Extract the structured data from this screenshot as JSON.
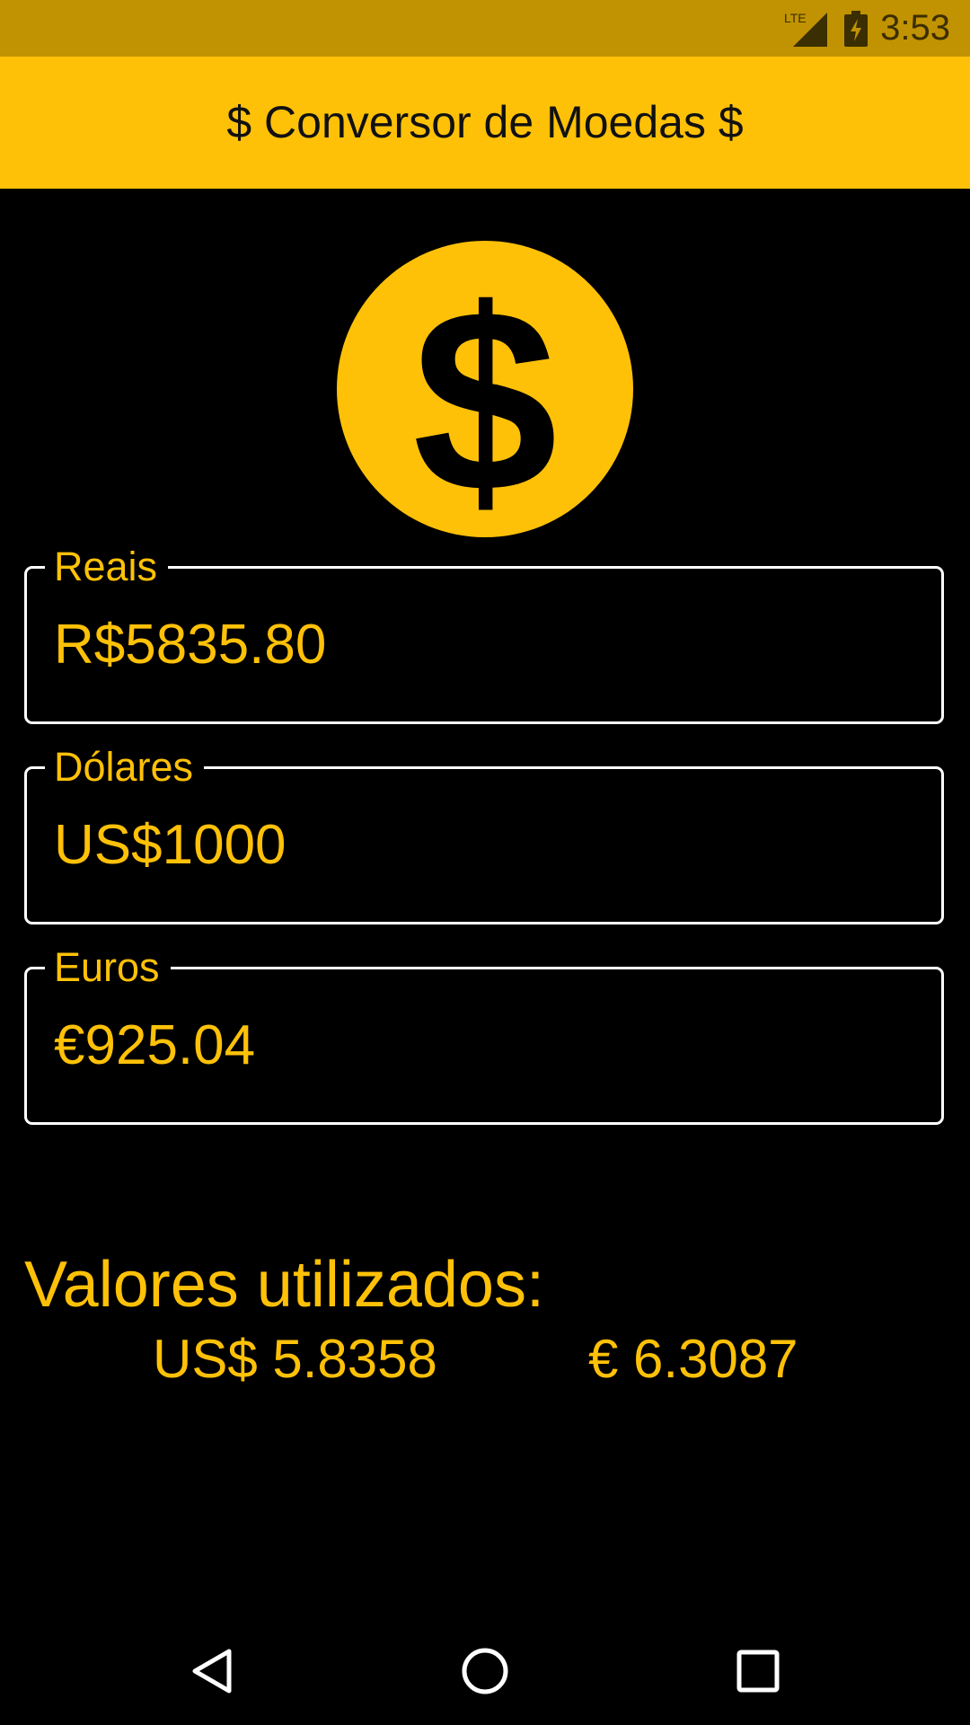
{
  "status_bar": {
    "time": "3:53",
    "network": "LTE",
    "bg_color": "#C19302"
  },
  "app_bar": {
    "title": "$ Conversor de Moedas $",
    "bg_color": "#FFC107"
  },
  "logo": {
    "icon": "dollar-coin-icon",
    "color": "#FFC107"
  },
  "fields": {
    "reais": {
      "label": "Reais",
      "value": "R$5835.80"
    },
    "dolares": {
      "label": "Dólares",
      "value": "US$1000"
    },
    "euros": {
      "label": "Euros",
      "value": "€925.04"
    }
  },
  "rates": {
    "title": "Valores utilizados:",
    "usd": "US$ 5.8358",
    "eur": "€ 6.3087"
  },
  "nav": {
    "back_icon": "back-icon",
    "home_icon": "home-icon",
    "recents_icon": "recents-icon"
  },
  "colors": {
    "accent": "#FFC107",
    "background": "#000000"
  }
}
